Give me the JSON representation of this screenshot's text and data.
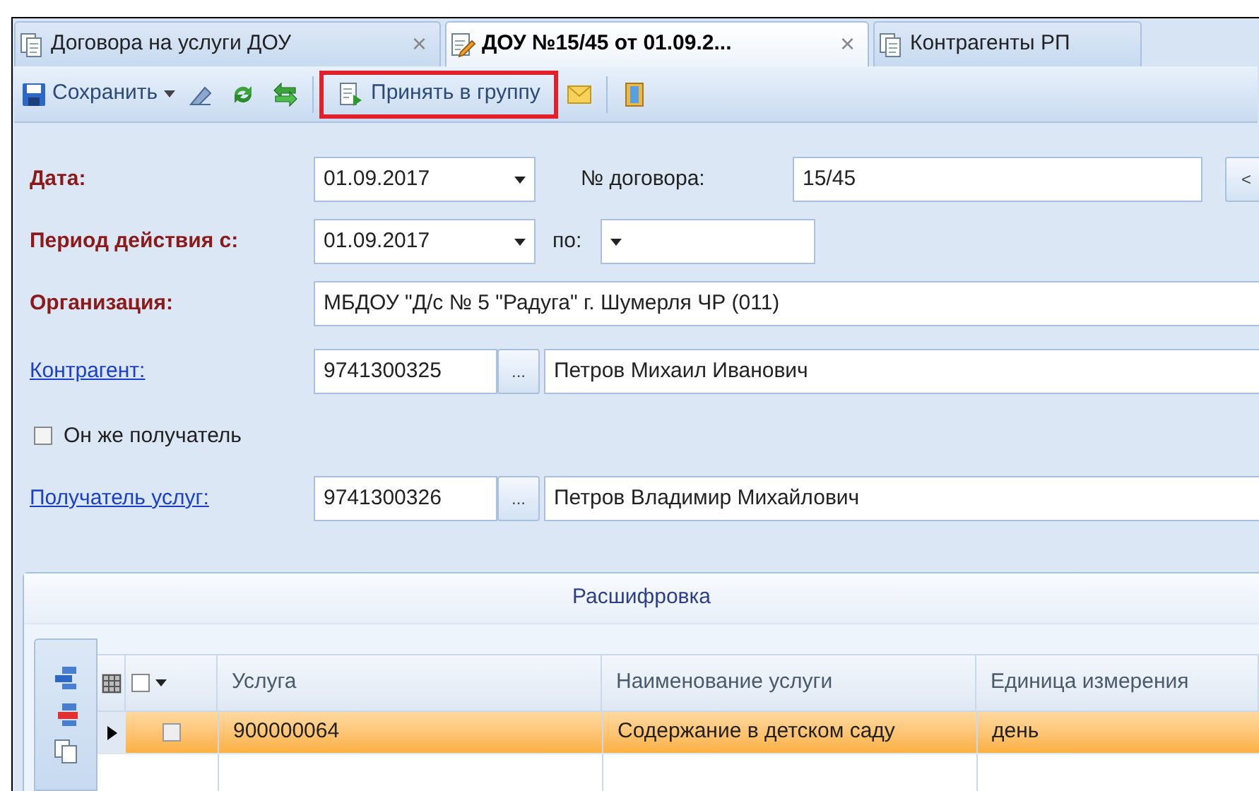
{
  "tabs": [
    {
      "label": "Договора на услуги ДОУ",
      "selected": false,
      "close": "×"
    },
    {
      "label": "ДОУ №15/45 от 01.09.2...",
      "selected": true,
      "close": "×"
    },
    {
      "label": "Контрагенты РП",
      "selected": false
    }
  ],
  "toolbar": [
    {
      "kind": "save",
      "label": "Сохранить"
    },
    {
      "kind": "pen"
    },
    {
      "kind": "refresh"
    },
    {
      "kind": "swap"
    },
    {
      "kind": "separator"
    },
    {
      "kind": "accept",
      "label": "Принять в группу",
      "highlighted": true
    },
    {
      "kind": "mail"
    },
    {
      "kind": "separator"
    },
    {
      "kind": "exit"
    }
  ],
  "form": {
    "date": {
      "label": "Дата:",
      "value": "01.09.2017"
    },
    "number": {
      "label": "№ договора:",
      "value": "15/45",
      "button": "<"
    },
    "period": {
      "label": "Период действия с:",
      "from": "01.09.2017",
      "to_label": "по:"
    },
    "organization": {
      "label": "Организация:",
      "value": "МБДОУ \"Д/с № 5 \"Радуга\" г. Шумерля ЧР (011)"
    },
    "contractor": {
      "label": "Контрагент:",
      "code": "9741300325",
      "button": "...",
      "name": "Петров Михаил Иванович"
    },
    "same_recipient": {
      "label": "Он же получатель",
      "checked": false
    },
    "recipient": {
      "label": "Получатель услуг:",
      "code": "9741300326",
      "button": "...",
      "name": "Петров Владимир Михайлович"
    }
  },
  "panel": {
    "title": "Расшифровка",
    "table": {
      "all_checked": false,
      "columns": [
        "Услуга",
        "Наименование услуги",
        "Единица измерения"
      ],
      "rows": [
        {
          "selected": true,
          "checked": false,
          "cells": [
            "900000064",
            "Содержание в детском саду",
            "день"
          ]
        }
      ]
    }
  }
}
